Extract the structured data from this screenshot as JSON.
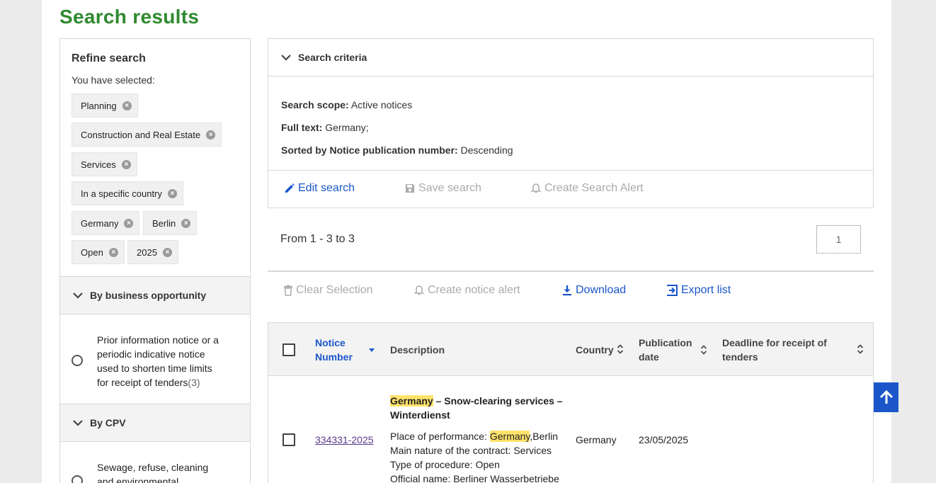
{
  "page": {
    "title": "Search results"
  },
  "refine": {
    "title": "Refine search",
    "selected_label": "You have selected:",
    "chips": [
      "Planning",
      "Construction and Real Estate",
      "Services",
      "In a specific country",
      "Germany",
      "Berlin",
      "Open",
      "2025"
    ]
  },
  "facets": [
    {
      "title": "By business opportunity",
      "option": "Prior information notice or a periodic indicative notice used to shorten time limits for receipt of tenders",
      "count": "(3)"
    },
    {
      "title": "By CPV",
      "option": "Sewage, refuse, cleaning and environmental"
    }
  ],
  "criteria": {
    "title": "Search criteria",
    "lines": [
      {
        "label": "Search scope:",
        "value": "Active notices"
      },
      {
        "label": "Full text:",
        "value": "Germany;"
      },
      {
        "label": "Sorted by Notice publication number:",
        "value": "Descending"
      }
    ],
    "actions": {
      "edit": "Edit search",
      "save": "Save search",
      "alert": "Create Search Alert"
    }
  },
  "results": {
    "count_text": "From 1 - 3 to 3",
    "page": "1",
    "toolbar": {
      "clear": "Clear Selection",
      "alert": "Create notice alert",
      "download": "Download",
      "export": "Export list"
    }
  },
  "table": {
    "headers": {
      "notice_number": "Notice Number",
      "description": "Description",
      "country": "Country",
      "publication_date": "Publication date",
      "deadline": "Deadline for receipt of tenders"
    },
    "rows": [
      {
        "notice_number": "334331-2025",
        "title_highlight": "Germany",
        "title_rest": " – Snow-clearing services – Winterdienst",
        "place_label": "Place of performance: ",
        "place_highlight": "Germany",
        "place_rest": ",Berlin",
        "nature": "Main nature of the contract: Services",
        "procedure": "Type of procedure: Open",
        "official_name": "Official name: Berliner Wasserbetriebe",
        "country": "Germany",
        "publication_date": "23/05/2025",
        "deadline": ""
      }
    ]
  },
  "colors": {
    "title_green": "#2f8a2f",
    "link_blue": "#1a56c9",
    "highlight": "#ffe36b"
  }
}
